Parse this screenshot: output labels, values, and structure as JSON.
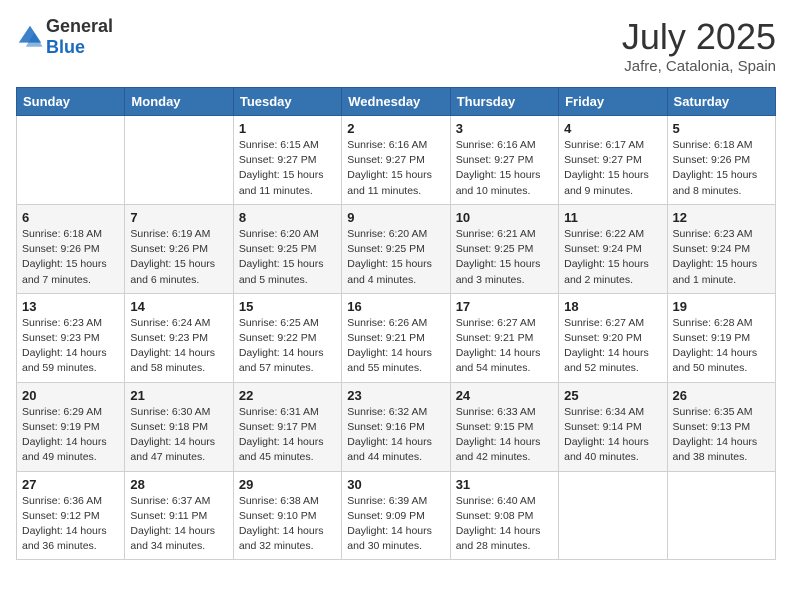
{
  "logo": {
    "general": "General",
    "blue": "Blue"
  },
  "header": {
    "month": "July 2025",
    "location": "Jafre, Catalonia, Spain"
  },
  "weekdays": [
    "Sunday",
    "Monday",
    "Tuesday",
    "Wednesday",
    "Thursday",
    "Friday",
    "Saturday"
  ],
  "weeks": [
    [
      {
        "day": "",
        "info": ""
      },
      {
        "day": "",
        "info": ""
      },
      {
        "day": "1",
        "info": "Sunrise: 6:15 AM\nSunset: 9:27 PM\nDaylight: 15 hours and 11 minutes."
      },
      {
        "day": "2",
        "info": "Sunrise: 6:16 AM\nSunset: 9:27 PM\nDaylight: 15 hours and 11 minutes."
      },
      {
        "day": "3",
        "info": "Sunrise: 6:16 AM\nSunset: 9:27 PM\nDaylight: 15 hours and 10 minutes."
      },
      {
        "day": "4",
        "info": "Sunrise: 6:17 AM\nSunset: 9:27 PM\nDaylight: 15 hours and 9 minutes."
      },
      {
        "day": "5",
        "info": "Sunrise: 6:18 AM\nSunset: 9:26 PM\nDaylight: 15 hours and 8 minutes."
      }
    ],
    [
      {
        "day": "6",
        "info": "Sunrise: 6:18 AM\nSunset: 9:26 PM\nDaylight: 15 hours and 7 minutes."
      },
      {
        "day": "7",
        "info": "Sunrise: 6:19 AM\nSunset: 9:26 PM\nDaylight: 15 hours and 6 minutes."
      },
      {
        "day": "8",
        "info": "Sunrise: 6:20 AM\nSunset: 9:25 PM\nDaylight: 15 hours and 5 minutes."
      },
      {
        "day": "9",
        "info": "Sunrise: 6:20 AM\nSunset: 9:25 PM\nDaylight: 15 hours and 4 minutes."
      },
      {
        "day": "10",
        "info": "Sunrise: 6:21 AM\nSunset: 9:25 PM\nDaylight: 15 hours and 3 minutes."
      },
      {
        "day": "11",
        "info": "Sunrise: 6:22 AM\nSunset: 9:24 PM\nDaylight: 15 hours and 2 minutes."
      },
      {
        "day": "12",
        "info": "Sunrise: 6:23 AM\nSunset: 9:24 PM\nDaylight: 15 hours and 1 minute."
      }
    ],
    [
      {
        "day": "13",
        "info": "Sunrise: 6:23 AM\nSunset: 9:23 PM\nDaylight: 14 hours and 59 minutes."
      },
      {
        "day": "14",
        "info": "Sunrise: 6:24 AM\nSunset: 9:23 PM\nDaylight: 14 hours and 58 minutes."
      },
      {
        "day": "15",
        "info": "Sunrise: 6:25 AM\nSunset: 9:22 PM\nDaylight: 14 hours and 57 minutes."
      },
      {
        "day": "16",
        "info": "Sunrise: 6:26 AM\nSunset: 9:21 PM\nDaylight: 14 hours and 55 minutes."
      },
      {
        "day": "17",
        "info": "Sunrise: 6:27 AM\nSunset: 9:21 PM\nDaylight: 14 hours and 54 minutes."
      },
      {
        "day": "18",
        "info": "Sunrise: 6:27 AM\nSunset: 9:20 PM\nDaylight: 14 hours and 52 minutes."
      },
      {
        "day": "19",
        "info": "Sunrise: 6:28 AM\nSunset: 9:19 PM\nDaylight: 14 hours and 50 minutes."
      }
    ],
    [
      {
        "day": "20",
        "info": "Sunrise: 6:29 AM\nSunset: 9:19 PM\nDaylight: 14 hours and 49 minutes."
      },
      {
        "day": "21",
        "info": "Sunrise: 6:30 AM\nSunset: 9:18 PM\nDaylight: 14 hours and 47 minutes."
      },
      {
        "day": "22",
        "info": "Sunrise: 6:31 AM\nSunset: 9:17 PM\nDaylight: 14 hours and 45 minutes."
      },
      {
        "day": "23",
        "info": "Sunrise: 6:32 AM\nSunset: 9:16 PM\nDaylight: 14 hours and 44 minutes."
      },
      {
        "day": "24",
        "info": "Sunrise: 6:33 AM\nSunset: 9:15 PM\nDaylight: 14 hours and 42 minutes."
      },
      {
        "day": "25",
        "info": "Sunrise: 6:34 AM\nSunset: 9:14 PM\nDaylight: 14 hours and 40 minutes."
      },
      {
        "day": "26",
        "info": "Sunrise: 6:35 AM\nSunset: 9:13 PM\nDaylight: 14 hours and 38 minutes."
      }
    ],
    [
      {
        "day": "27",
        "info": "Sunrise: 6:36 AM\nSunset: 9:12 PM\nDaylight: 14 hours and 36 minutes."
      },
      {
        "day": "28",
        "info": "Sunrise: 6:37 AM\nSunset: 9:11 PM\nDaylight: 14 hours and 34 minutes."
      },
      {
        "day": "29",
        "info": "Sunrise: 6:38 AM\nSunset: 9:10 PM\nDaylight: 14 hours and 32 minutes."
      },
      {
        "day": "30",
        "info": "Sunrise: 6:39 AM\nSunset: 9:09 PM\nDaylight: 14 hours and 30 minutes."
      },
      {
        "day": "31",
        "info": "Sunrise: 6:40 AM\nSunset: 9:08 PM\nDaylight: 14 hours and 28 minutes."
      },
      {
        "day": "",
        "info": ""
      },
      {
        "day": "",
        "info": ""
      }
    ]
  ]
}
